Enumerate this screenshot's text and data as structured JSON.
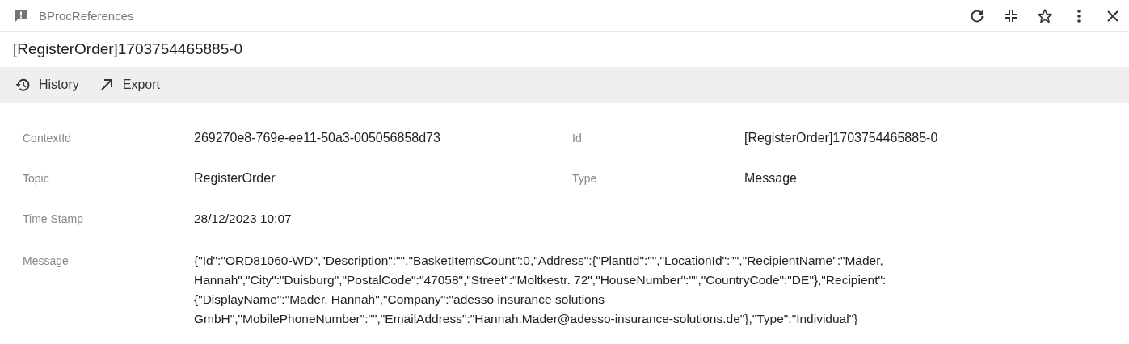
{
  "window": {
    "title": "BProcReferences"
  },
  "heading": "[RegisterOrder]1703754465885-0",
  "toolbar": [
    {
      "kind": "history",
      "label": "History"
    },
    {
      "kind": "export",
      "label": "Export"
    }
  ],
  "rows": [
    [
      {
        "label": "ContextId",
        "value": "269270e8-769e-ee11-50a3-005056858d73"
      },
      {
        "label": "Id",
        "value": "[RegisterOrder]1703754465885-0"
      }
    ],
    [
      {
        "label": "Topic",
        "value": "RegisterOrder"
      },
      {
        "label": "Type",
        "value": "Message"
      }
    ],
    [
      {
        "label": "Time Stamp",
        "value": "28/12/2023 10:07"
      }
    ],
    [
      {
        "label": "Message",
        "value": "{\"Id\":\"ORD81060-WD\",\"Description\":\"\",\"BasketItemsCount\":0,\"Address\":{\"PlantId\":\"\",\"LocationId\":\"\",\"RecipientName\":\"Mader, Hannah\",\"City\":\"Duisburg\",\"PostalCode\":\"47058\",\"Street\":\"Moltkestr. 72\",\"HouseNumber\":\"\",\"CountryCode\":\"DE\"},\"Recipient\":{\"DisplayName\":\"Mader, Hannah\",\"Company\":\"adesso insurance solutions GmbH\",\"MobilePhoneNumber\":\"\",\"EmailAddress\":\"Hannah.Mader@adesso-insurance-solutions.de\"},\"Type\":\"Individual\"}"
      }
    ]
  ]
}
